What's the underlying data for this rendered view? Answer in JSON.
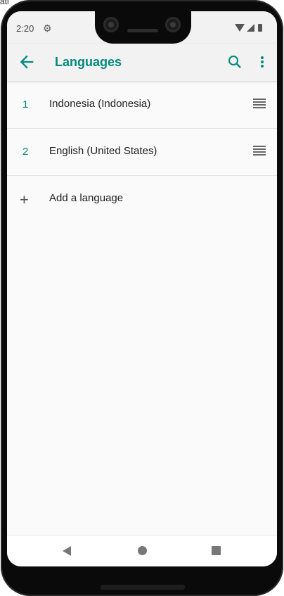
{
  "corner_label": "ati",
  "status_bar": {
    "time": "2:20",
    "settings_icon": "gear-icon",
    "right_icons": [
      "wifi-icon",
      "signal-icon",
      "battery-icon"
    ]
  },
  "app_bar": {
    "title": "Languages",
    "back_icon": "arrow-left-icon",
    "search_icon": "search-icon",
    "more_icon": "more-vert-icon",
    "accent_color": "#00897b"
  },
  "languages": [
    {
      "index": "1",
      "name": "Indonesia (Indonesia)"
    },
    {
      "index": "2",
      "name": "English (United States)"
    }
  ],
  "add_language": {
    "icon": "plus-icon",
    "label": "Add a language"
  },
  "nav_bar": {
    "back": "back-triangle-icon",
    "home": "home-circle-icon",
    "recents": "recents-square-icon"
  }
}
